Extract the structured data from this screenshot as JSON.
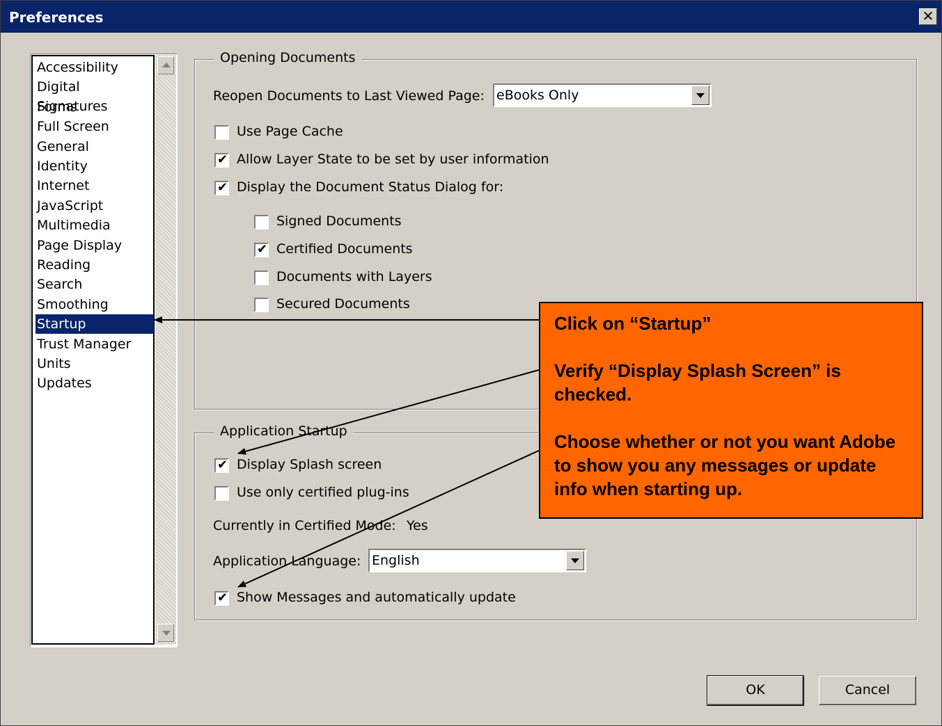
{
  "window": {
    "title": "Preferences",
    "close_glyph": "✕"
  },
  "sidebar": {
    "items": [
      {
        "label": "Accessibility"
      },
      {
        "label": "Digital Signatures"
      },
      {
        "label": "Forms"
      },
      {
        "label": "Full Screen"
      },
      {
        "label": "General"
      },
      {
        "label": "Identity"
      },
      {
        "label": "Internet"
      },
      {
        "label": "JavaScript"
      },
      {
        "label": "Multimedia"
      },
      {
        "label": "Page Display"
      },
      {
        "label": "Reading"
      },
      {
        "label": "Search"
      },
      {
        "label": "Smoothing"
      },
      {
        "label": "Startup",
        "selected": true
      },
      {
        "label": "Trust Manager"
      },
      {
        "label": "Units"
      },
      {
        "label": "Updates"
      }
    ]
  },
  "opening": {
    "group_label": "Opening Documents",
    "reopen_label": "Reopen Documents to Last Viewed Page:",
    "reopen_value": "eBooks Only",
    "page_cache": {
      "label": "Use Page Cache",
      "checked": false
    },
    "layer_state": {
      "label": "Allow Layer State to be set by user information",
      "checked": true
    },
    "status_dialog": {
      "label": "Display the Document Status Dialog for:",
      "checked": true
    },
    "signed": {
      "label": "Signed Documents",
      "checked": false
    },
    "certified": {
      "label": "Certified Documents",
      "checked": true
    },
    "layers": {
      "label": "Documents with Layers",
      "checked": false
    },
    "secured": {
      "label": "Secured Documents",
      "checked": false
    }
  },
  "startup": {
    "group_label": "Application Startup",
    "splash": {
      "label": "Display Splash screen",
      "checked": true
    },
    "certified_plugins": {
      "label": "Use only certified plug-ins",
      "checked": false
    },
    "certified_mode_label": "Currently in Certified Mode:",
    "certified_mode_value": "Yes",
    "language_label": "Application Language:",
    "language_value": "English",
    "messages": {
      "label": "Show Messages and automatically update",
      "checked": true
    }
  },
  "buttons": {
    "ok": "OK",
    "cancel": "Cancel"
  },
  "callout": {
    "line1": "Click on “Startup”",
    "line2": "Verify “Display Splash Screen” is checked.",
    "line3": "Choose whether or not you want Adobe to show you any messages or update info when starting up.",
    "color": "#ff6600"
  },
  "check_glyph": "✔"
}
